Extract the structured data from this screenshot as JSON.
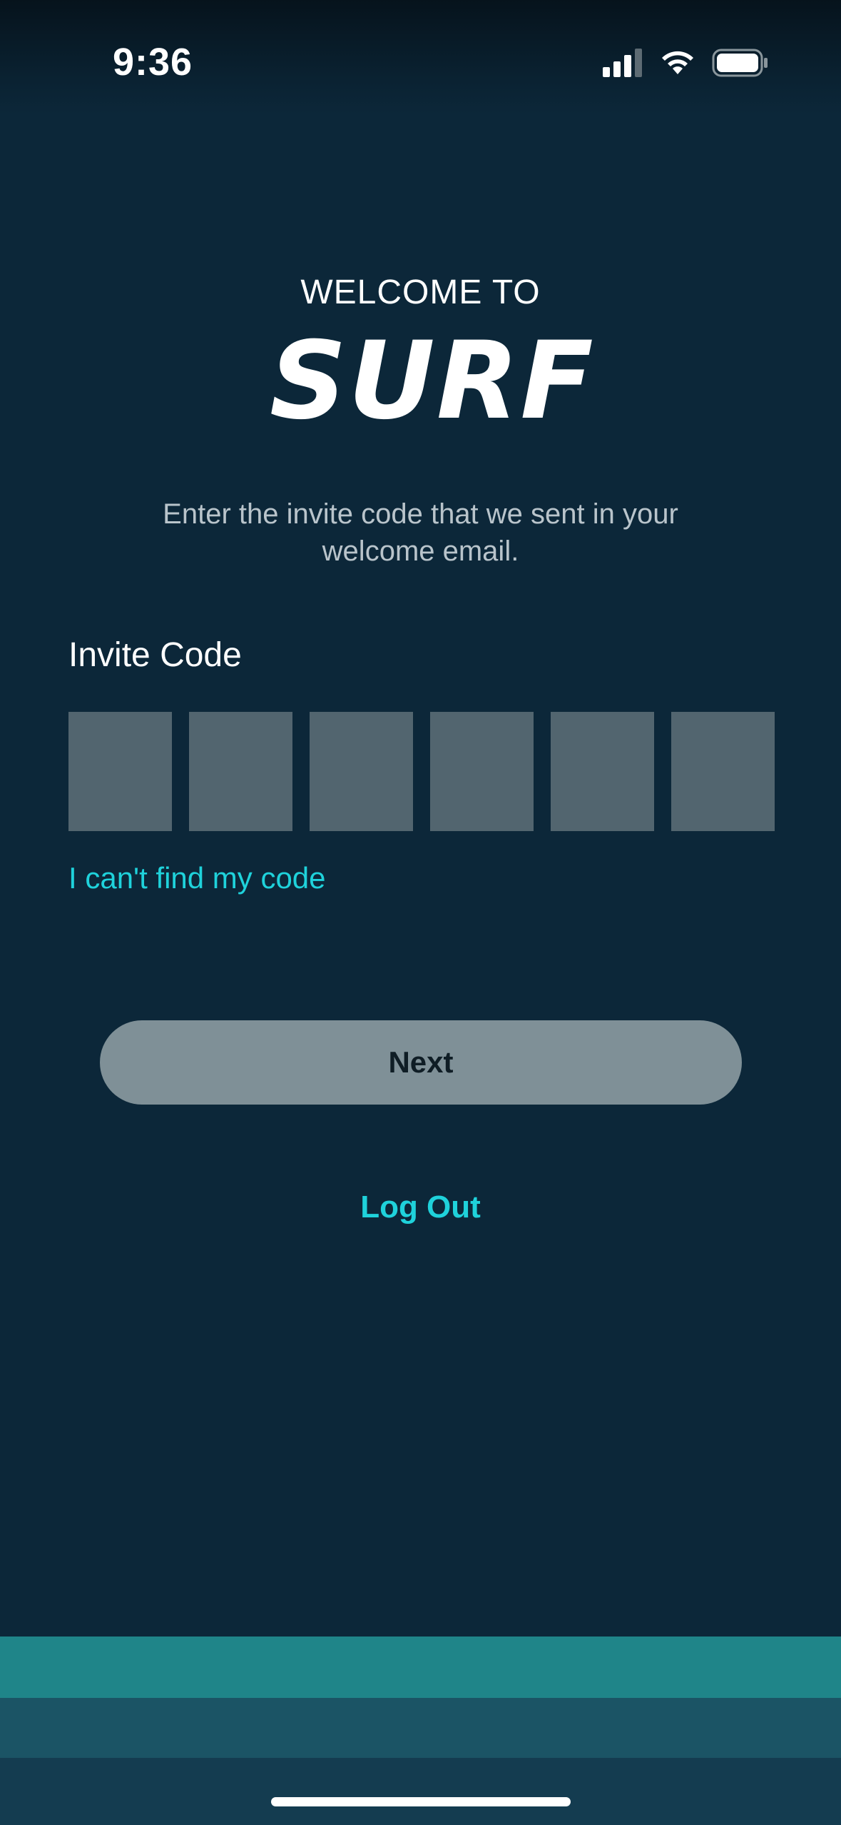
{
  "status_bar": {
    "time": "9:36",
    "icons": [
      "cellular-signal-icon",
      "wifi-icon",
      "battery-icon"
    ]
  },
  "header": {
    "welcome": "WELCOME TO",
    "logo_text": "SURF"
  },
  "instructions": "Enter the invite code that we sent in your welcome email.",
  "invite": {
    "label": "Invite Code",
    "boxes": [
      "",
      "",
      "",
      "",
      "",
      ""
    ],
    "cant_find_label": "I can't find my code"
  },
  "actions": {
    "next_label": "Next",
    "logout_label": "Log Out"
  },
  "colors": {
    "background": "#0c2739",
    "accent": "#1fd2db",
    "code_box": "#52656f",
    "button_disabled": "#7f9097"
  }
}
